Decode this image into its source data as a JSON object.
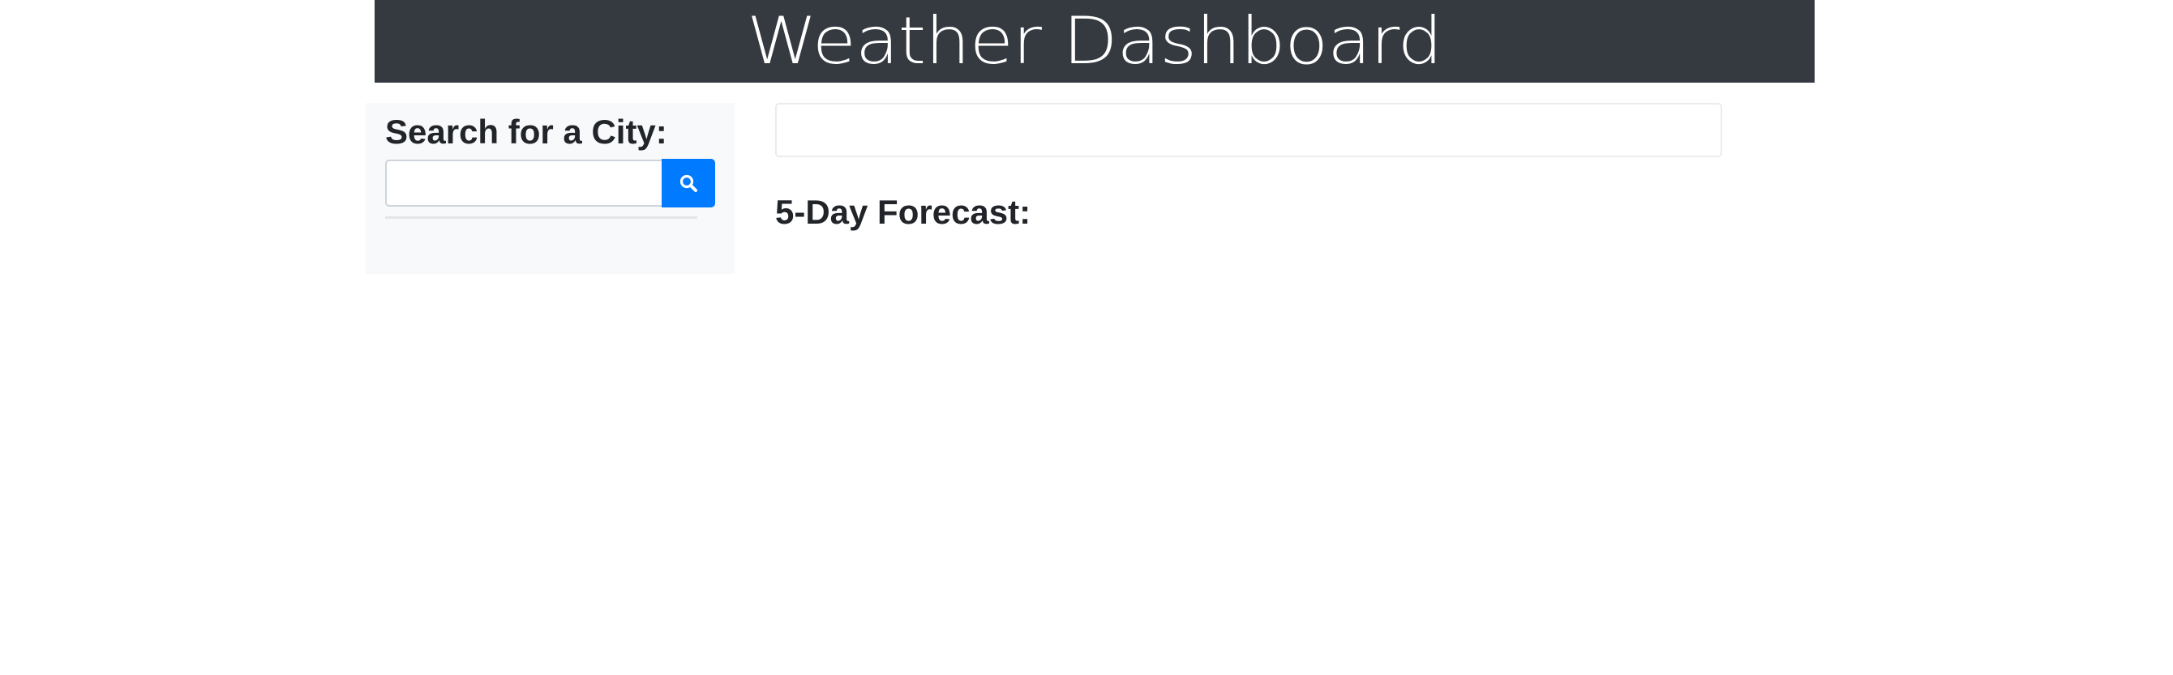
{
  "header": {
    "title": "Weather Dashboard",
    "background_color": "#343a40",
    "text_color": "#ffffff"
  },
  "sidebar": {
    "title": "Search for a City:",
    "background_color": "#f8f9fa",
    "search": {
      "value": "",
      "placeholder": ""
    },
    "search_button": {
      "icon": "search-icon",
      "color": "#007bff"
    }
  },
  "main": {
    "current_weather": "",
    "forecast_title": "5-Day Forecast:"
  }
}
